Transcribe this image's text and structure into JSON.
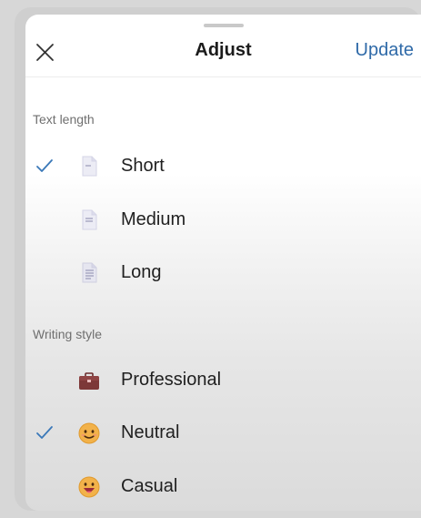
{
  "header": {
    "title": "Adjust",
    "update_label": "Update",
    "close_icon": "close-icon"
  },
  "text_length": {
    "label": "Text length",
    "options": [
      {
        "label": "Short",
        "icon": "document-icon",
        "selected": true
      },
      {
        "label": "Medium",
        "icon": "document-icon",
        "selected": false
      },
      {
        "label": "Long",
        "icon": "document-icon",
        "selected": false
      }
    ]
  },
  "writing_style": {
    "label": "Writing style",
    "options": [
      {
        "label": "Professional",
        "icon": "briefcase-icon",
        "selected": false
      },
      {
        "label": "Neutral",
        "icon": "smiley-icon",
        "selected": true
      },
      {
        "label": "Casual",
        "icon": "grinning-face-icon",
        "selected": false
      }
    ]
  },
  "colors": {
    "accent": "#2f6aa8",
    "check": "#3a78b8"
  }
}
